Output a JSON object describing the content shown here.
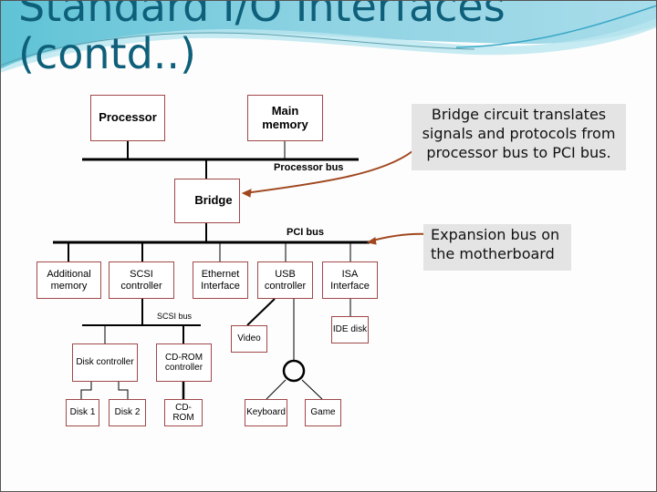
{
  "slide": {
    "title_line1": "Standard I/O Interfaces",
    "title_line2": "(contd..)"
  },
  "diagram": {
    "processor": "Processor",
    "main_memory": "Main memory",
    "processor_bus": "Processor bus",
    "bridge": "Bridge",
    "pci_bus": "PCI bus",
    "additional_memory": "Additional memory",
    "scsi_controller": "SCSI controller",
    "ethernet_interface": "Ethernet Interface",
    "usb_controller": "USB controller",
    "isa_interface": "ISA Interface",
    "scsi_bus": "SCSI bus",
    "video": "Video",
    "ide_disk": "IDE disk",
    "disk_controller": "Disk controller",
    "cdrom_controller": "CD-ROM controller",
    "disk1": "Disk 1",
    "disk2": "Disk 2",
    "cdrom": "CD-ROM",
    "keyboard": "Keyboard",
    "game": "Game"
  },
  "callouts": {
    "bridge_note": "Bridge circuit translates signals and protocols from processor bus to PCI bus.",
    "pci_note": "Expansion bus on the motherboard"
  },
  "colors": {
    "title": "#0e5f7a",
    "box_border": "#a0484a",
    "arrow": "#a0471f",
    "callout_bg": "#e4e4e4"
  }
}
